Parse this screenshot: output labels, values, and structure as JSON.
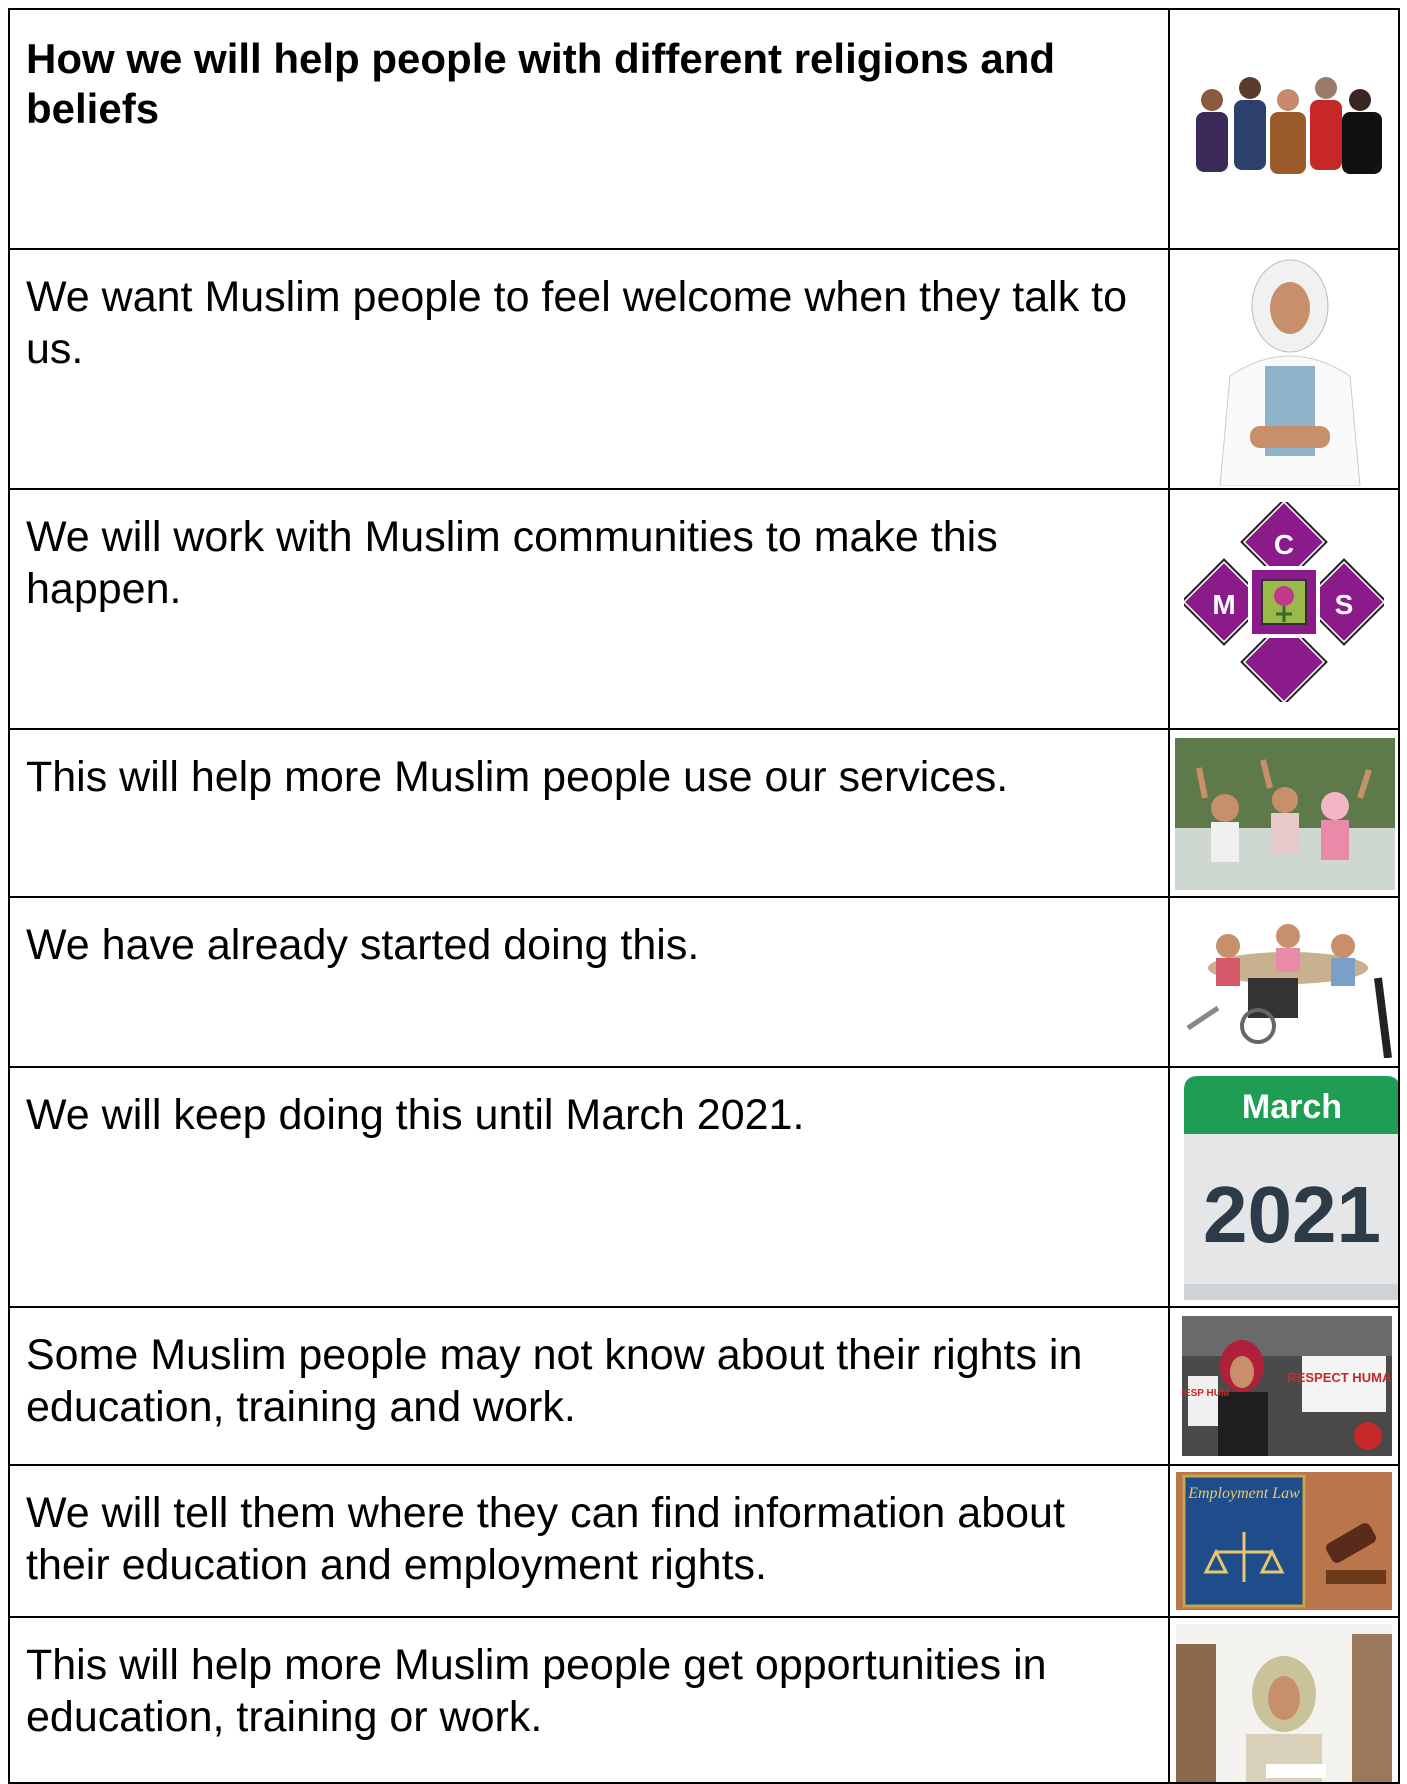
{
  "rows": [
    {
      "text": "How we will help people with different religions and beliefs",
      "image": "group-of-people-image"
    },
    {
      "text": "We want Muslim people to feel welcome when they talk to us.",
      "image": "woman-in-hijab-image"
    },
    {
      "text": "We will work with Muslim communities to make this happen.",
      "image": "mcs-logo"
    },
    {
      "text": "This will help more Muslim people use our services.",
      "image": "people-waving-image"
    },
    {
      "text": "We have already started doing this.",
      "image": "meeting-image"
    },
    {
      "text": "We will keep doing this until March 2021.",
      "image": "calendar-icon"
    },
    {
      "text": "Some Muslim people may not know about their rights in education, training and work.",
      "image": "protest-image"
    },
    {
      "text": "We will tell them where they can find information about their education and employment rights.",
      "image": "employment-law-book-image"
    },
    {
      "text": "This will help more Muslim people get opportunities in education, training or work.",
      "image": "student-studying-image"
    }
  ],
  "logo": {
    "letters": [
      "C",
      "M",
      "S"
    ]
  },
  "calendar": {
    "month": "March",
    "year": "2021",
    "header_color": "#1f9d55"
  },
  "protest": {
    "sign_left": "RESP HUM",
    "sign_right": "RESPECT HUMAN"
  },
  "book": {
    "title": "Employment Law"
  }
}
